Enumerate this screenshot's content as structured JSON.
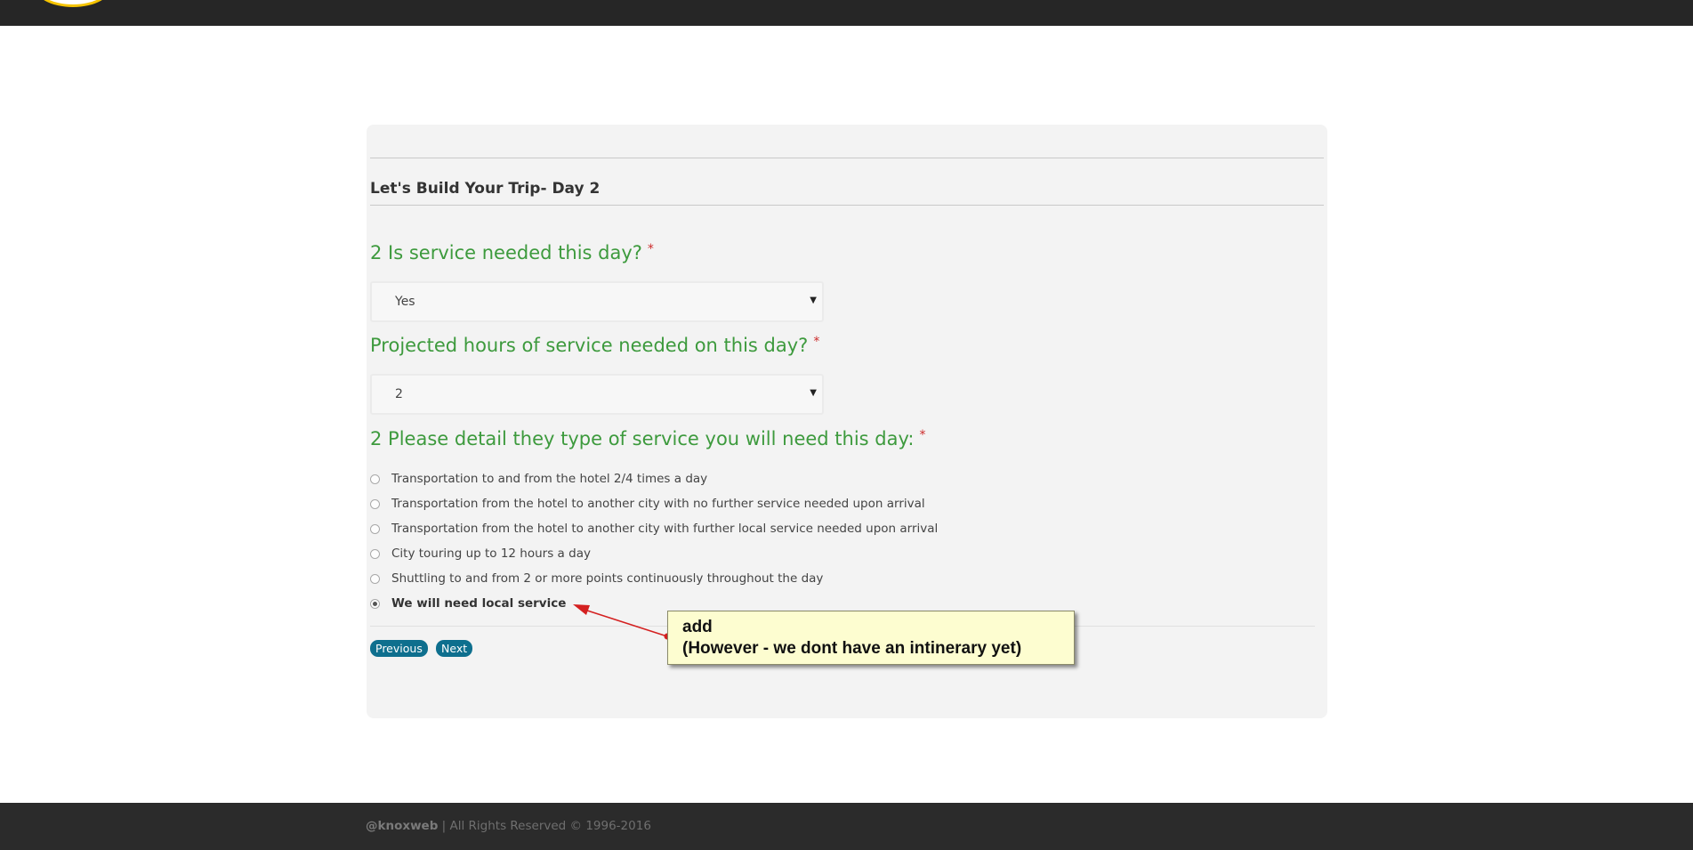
{
  "form": {
    "section_title": "Let's Build Your Trip- Day 2",
    "q1": {
      "label": "2 Is service needed this day?",
      "required_mark": "*",
      "value": "Yes"
    },
    "q2": {
      "label": "Projected hours of service needed on this day?",
      "required_mark": "*",
      "value": "2"
    },
    "q3": {
      "label": "2 Please detail they type of service you will need this day:",
      "required_mark": "*",
      "options": [
        {
          "label": "Transportation to and from the hotel 2/4 times a day",
          "checked": false
        },
        {
          "label": "Transportation from the hotel to another city with no further service needed upon arrival",
          "checked": false
        },
        {
          "label": "Transportation from the hotel to another city with further local service needed upon arrival",
          "checked": false
        },
        {
          "label": "City touring up to 12 hours a day",
          "checked": false
        },
        {
          "label": "Shuttling to and from 2 or more points continuously throughout the day",
          "checked": false
        },
        {
          "label": "We will need local service",
          "checked": true
        }
      ]
    },
    "buttons": {
      "previous": "Previous",
      "next": "Next"
    }
  },
  "annotation": {
    "line1": "add",
    "line2": "(However - we dont have an intinerary yet)",
    "color": "#fdfdd0",
    "arrow_color": "#d42020"
  },
  "footer": {
    "brand": "@knoxweb",
    "text": " | All Rights Reserved © 1996-2016"
  },
  "colors": {
    "question": "#3d9a3d",
    "button": "#0e6f8e",
    "required": "#cc2b2b"
  }
}
